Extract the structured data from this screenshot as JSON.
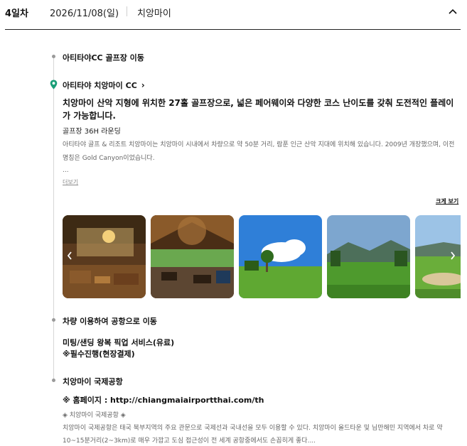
{
  "day": {
    "label": "4일차",
    "date": "2026/11/08(일)",
    "city": "치앙마이"
  },
  "steps": {
    "move_to_golf": "아티타야CC 골프장 이동",
    "place_name": "아티타야 치앙마이 CC",
    "place_desc": "치앙마이 산악 지형에 위치한 27홀 골프장으로, 넓은 페어웨이와 다양한 코스 난이도를 갖춰 도전적인 플레이가 가능합니다.",
    "place_sub": "골프장 36H 라운딩",
    "place_detail": "아티타야 골프 & 리조트 치앙마이는 치앙마이 시내에서 차량으로 약 50분 거리, 람푼 인근 산악 지대에 위치해 있습니다. 2009년 개장했으며, 이전 명칭은 Gold Canyon이었습니다.",
    "ellipsis": "...",
    "more": "더보기",
    "enlarge": "크게 보기",
    "move_to_airport": "차량 이용하여 공항으로 이동",
    "transfer_line1": "미팅/샌딩 왕복 픽업 서비스(유료)",
    "transfer_line2": "※필수진행(현장결제)",
    "airport_title": "치앙마이 국제공항",
    "homepage": "※ 홈페이지 : http://chiangmaiairportthai.com/th",
    "airport_caption": "◈ 치앙마이 국제공항 ◈",
    "airport_detail": "치앙마이 국제공항은 태국 북부지역의 주요 관문으로 국제선과 국내선을 모두 이용할 수 있다. 치앙마이 올드타운 및 님만해민 지역에서 차로 약 10~15분거리(2~3km)로 매우 가깝고 도심 접근성이 전 세계 공항중에서도 손꼽히게 좋다...."
  },
  "icons": {
    "collapse": "chevron-up-icon",
    "pin": "map-pin-icon",
    "link_chevron": "chevron-right-icon",
    "prev": "chevron-left-icon",
    "next": "chevron-right-icon"
  },
  "colors": {
    "pin": "#1a9e77",
    "timeline": "#d6d6d6",
    "dot": "#9a9a9a"
  }
}
